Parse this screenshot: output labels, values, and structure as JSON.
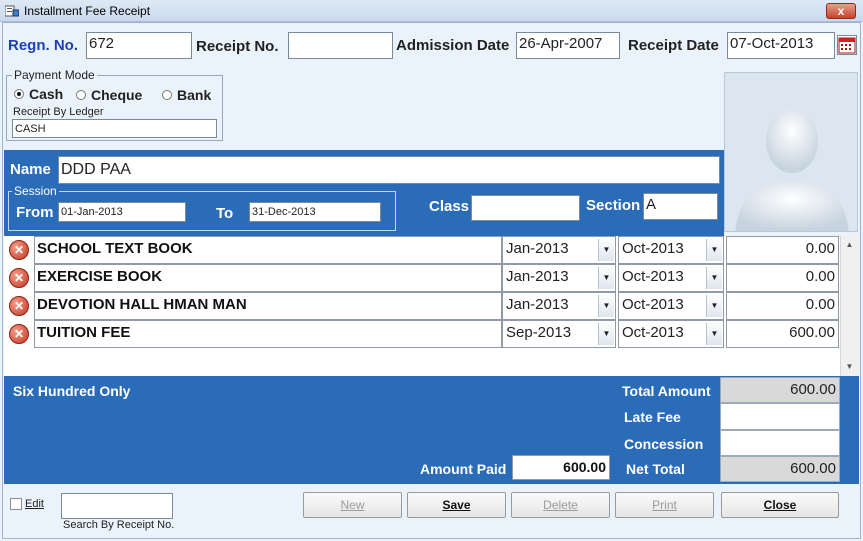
{
  "window": {
    "title": "Installment Fee Receipt",
    "close_label": "x"
  },
  "header": {
    "regn_label": "Regn. No.",
    "regn_value": "672",
    "receipt_label": "Receipt No.",
    "receipt_value": "",
    "admission_label": "Admission Date",
    "admission_value": "26-Apr-2007",
    "receipt_date_label": "Receipt Date",
    "receipt_date_value": "07-Oct-2013"
  },
  "payment_mode": {
    "legend": "Payment Mode",
    "options": [
      {
        "label": "Cash",
        "selected": true
      },
      {
        "label": "Cheque",
        "selected": false
      },
      {
        "label": "Bank",
        "selected": false
      }
    ],
    "ledger_label": "Receipt By Ledger",
    "ledger_value": "CASH"
  },
  "student": {
    "name_label": "Name",
    "name_value": "DDD PAA",
    "session_legend": "Session",
    "from_label": "From",
    "from_value": "01-Jan-2013",
    "to_label": "To",
    "to_value": "31-Dec-2013",
    "class_label": "Class",
    "class_value": "",
    "section_label": "Section",
    "section_value": "A"
  },
  "fees": [
    {
      "name": "SCHOOL TEXT BOOK",
      "from": "Jan-2013",
      "to": "Oct-2013",
      "amount": "0.00"
    },
    {
      "name": "EXERCISE BOOK",
      "from": "Jan-2013",
      "to": "Oct-2013",
      "amount": "0.00"
    },
    {
      "name": "DEVOTION HALL HMAN MAN",
      "from": "Jan-2013",
      "to": "Oct-2013",
      "amount": "0.00"
    },
    {
      "name": "TUITION FEE",
      "from": "Sep-2013",
      "to": "Oct-2013",
      "amount": "600.00"
    }
  ],
  "totals": {
    "words": "Six Hundred Only",
    "total_amount_label": "Total Amount",
    "total_amount_value": "600.00",
    "late_fee_label": "Late Fee",
    "late_fee_value": "",
    "concession_label": "Concession",
    "concession_value": "",
    "amount_paid_label": "Amount Paid",
    "amount_paid_value": "600.00",
    "net_total_label": "Net Total",
    "net_total_value": "600.00"
  },
  "footer": {
    "edit_label": "Edit",
    "search_value": "",
    "search_caption": "Search By Receipt No.",
    "buttons": {
      "new": "New",
      "save": "Save",
      "delete": "Delete",
      "print": "Print",
      "close": "Close"
    }
  },
  "colors": {
    "panel_blue": "#2b6cb9",
    "background": "#eaf3fb",
    "label_blue": "#1b3fb5"
  }
}
